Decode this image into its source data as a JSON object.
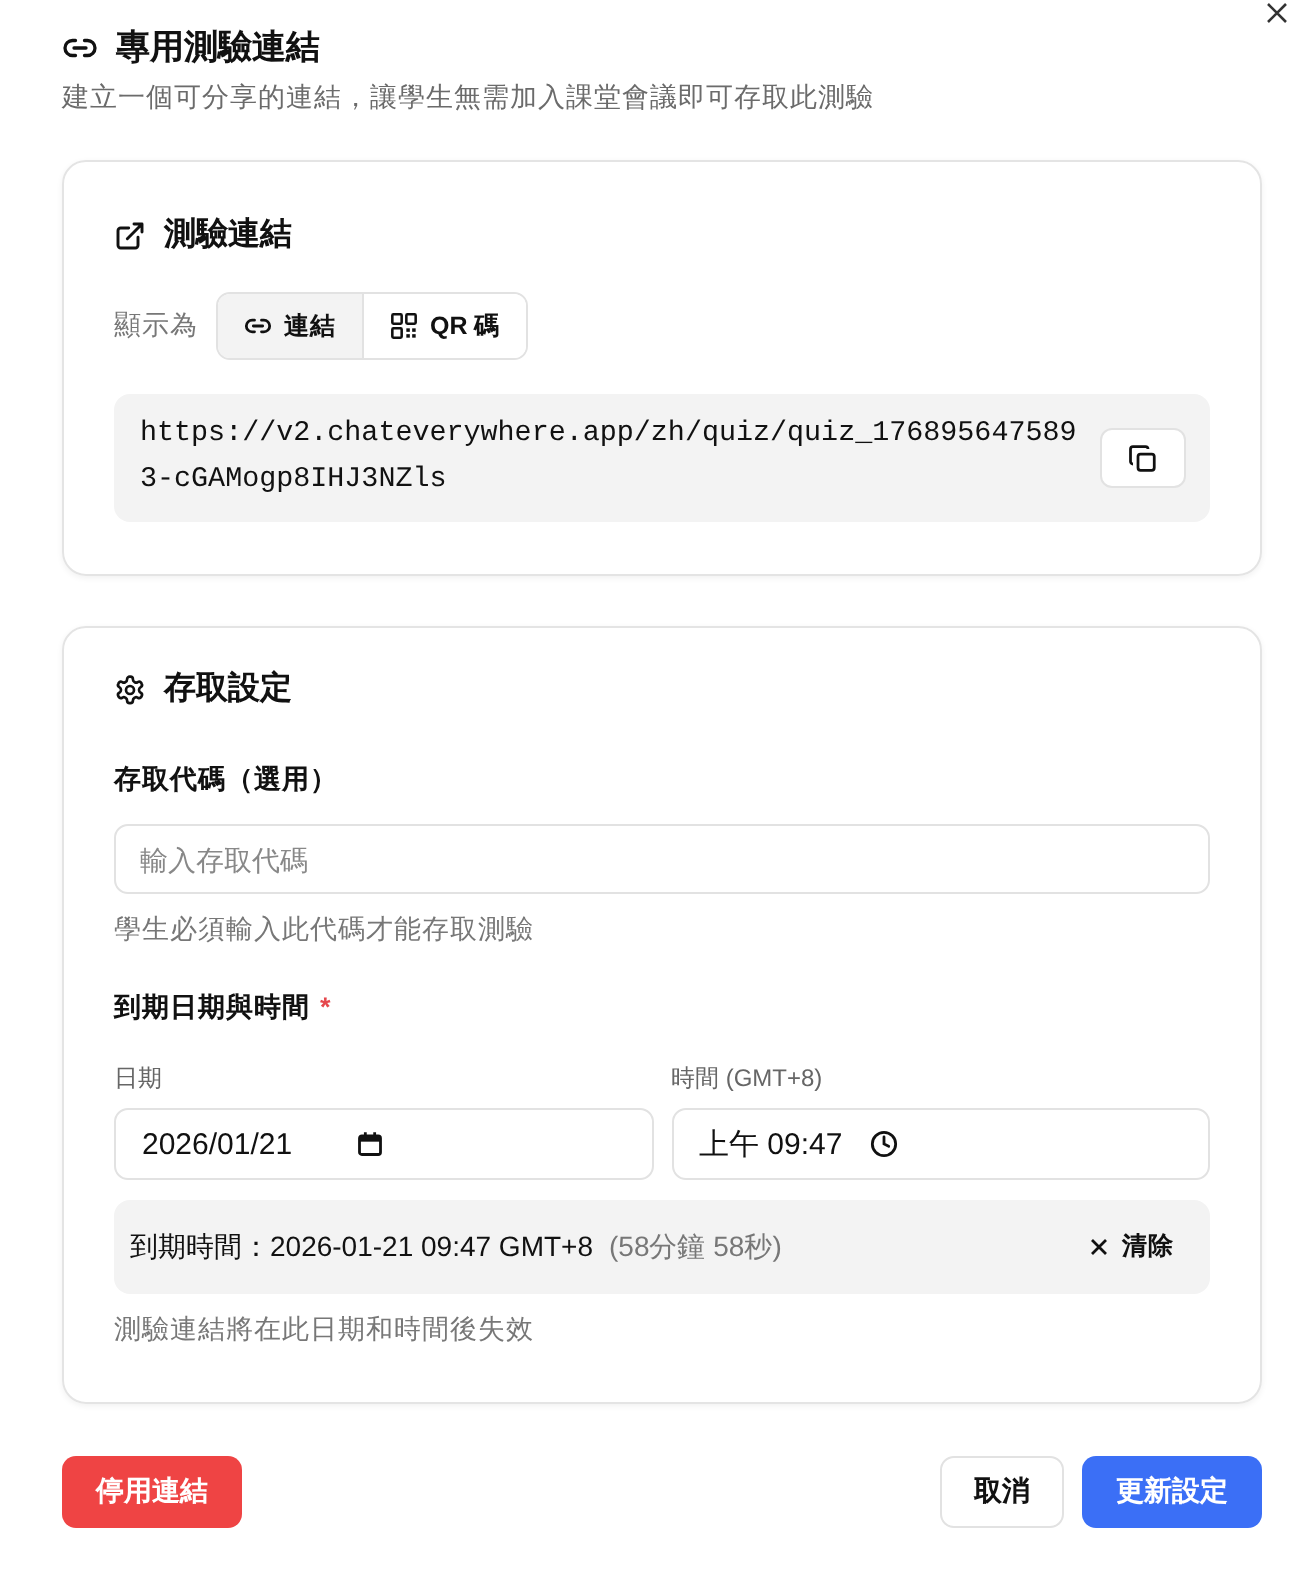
{
  "dialog": {
    "title": "專用測驗連結",
    "subtitle": "建立一個可分享的連結，讓學生無需加入課堂會議即可存取此測驗"
  },
  "link_card": {
    "title": "測驗連結",
    "display_label": "顯示為",
    "display_options": [
      {
        "label": "連結",
        "kind": "link",
        "selected": true
      },
      {
        "label": "QR 碼",
        "kind": "qr",
        "selected": false
      }
    ],
    "url": "https://v2.chateverywhere.app/zh/quiz/quiz_1768956475893-cGAMogp8IHJ3NZls"
  },
  "access_card": {
    "title": "存取設定",
    "access_code": {
      "label": "存取代碼（選用）",
      "placeholder": "輸入存取代碼",
      "help": "學生必須輸入此代碼才能存取測驗"
    },
    "expiry": {
      "label": "到期日期與時間",
      "required_mark": "*",
      "date_label": "日期",
      "date_value": "2026/01/21",
      "time_label": "時間 (GMT+8)",
      "time_value": "上午 09:47",
      "summary": "到期時間：2026-01-21 09:47 GMT+8",
      "remaining": "(58分鐘 58秒)",
      "clear_button": "清除",
      "help": "測驗連結將在此日期和時間後失效"
    }
  },
  "footer": {
    "buttons": [
      {
        "label": "停用連結",
        "kind": "danger"
      },
      {
        "label": "取消",
        "kind": "secondary"
      },
      {
        "label": "更新設定",
        "kind": "primary"
      }
    ]
  }
}
